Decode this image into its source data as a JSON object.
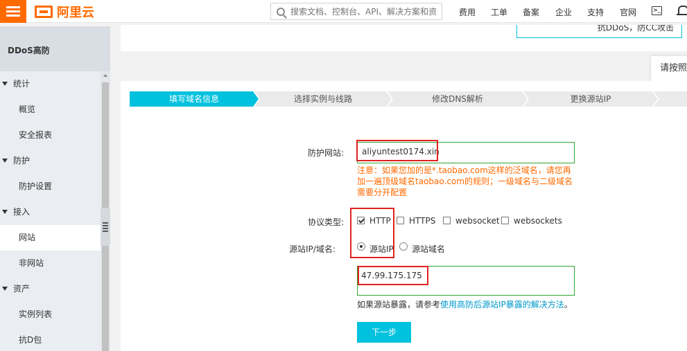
{
  "header": {
    "brand": "阿里云",
    "search_placeholder": "搜索文档、控制台、API、解决方案和资源",
    "nav": [
      "费用",
      "工单",
      "备案",
      "企业",
      "支持",
      "官网"
    ],
    "terminal_icon_glyph": ">_"
  },
  "sidebar": {
    "title": "DDoS高防",
    "groups": [
      {
        "label": "统计",
        "items": [
          "概览",
          "安全报表"
        ]
      },
      {
        "label": "防护",
        "items": [
          "防护设置"
        ]
      },
      {
        "label": "接入",
        "items": [
          "网站",
          "非网站"
        ]
      },
      {
        "label": "资产",
        "items": [
          "实例列表",
          "抗D包"
        ]
      }
    ],
    "active_item": "网站"
  },
  "notice": {
    "text": "抗DDoS，防CC攻击"
  },
  "side_tab": {
    "label": "请按照"
  },
  "steps": [
    "填写域名信息",
    "选择实例与线路",
    "修改DNS解析",
    "更换源站IP"
  ],
  "form": {
    "site_label": "防护网站:",
    "site_value": "aliyuntest0174.xin",
    "warning": "注意：如果您加的是*.taobao.com这样的泛域名，请您再加一遍顶级域名taobao.com的规则；一级域名与二级域名需要分开配置",
    "protocol_label": "协议类型:",
    "protocols": [
      {
        "label": "HTTP",
        "checked": true
      },
      {
        "label": "HTTPS",
        "checked": false
      },
      {
        "label": "websocket",
        "checked": false
      },
      {
        "label": "websockets",
        "checked": false
      }
    ],
    "origin_label": "源站IP/域名:",
    "origin_options": [
      {
        "label": "源站IP",
        "selected": true
      },
      {
        "label": "源站域名",
        "selected": false
      }
    ],
    "origin_value": "47.99.175.175",
    "hint_prefix": "如果源站暴露，请参考",
    "hint_link": "使用高防后源站IP暴露的解决方法",
    "hint_suffix": "。",
    "next_button": "下一步"
  },
  "colors": {
    "brand": "#ff6a00",
    "accent": "#00c1de",
    "warning": "#ff6a00",
    "link": "#0099cc",
    "highlight": "#e02020",
    "field_border": "#2fa52f"
  }
}
